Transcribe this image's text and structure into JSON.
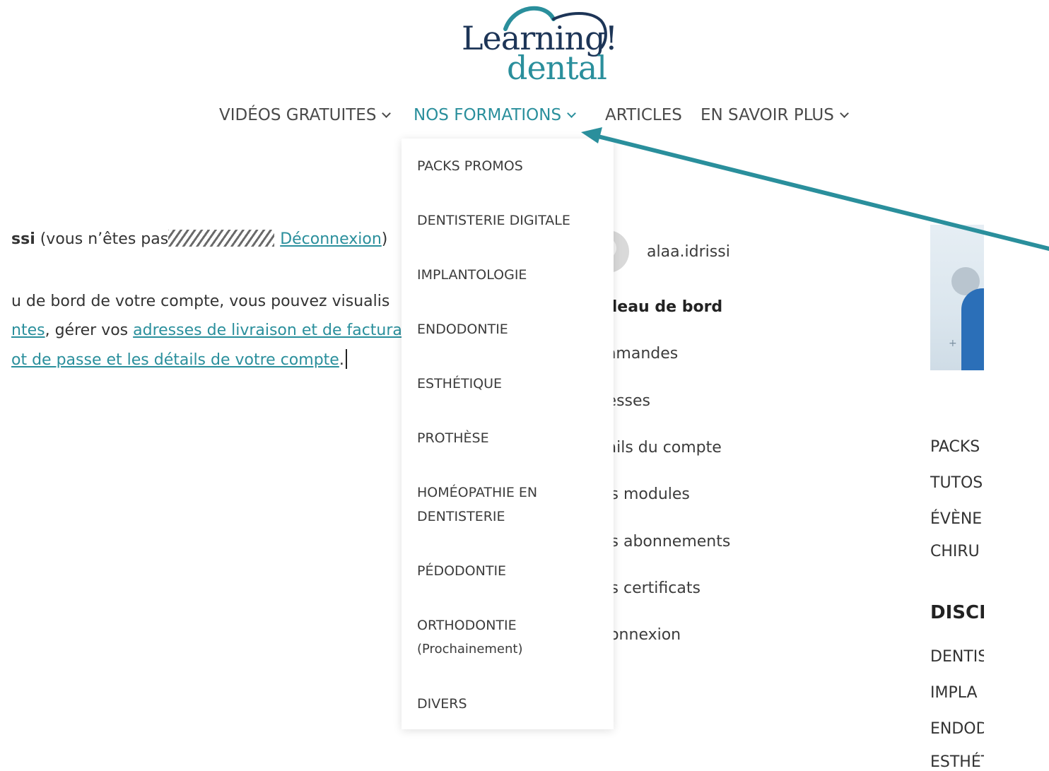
{
  "logo": {
    "line1": "Learning!",
    "line2": "dental",
    "brand_navy": "#1d3557",
    "brand_teal": "#2a8f9c"
  },
  "nav": {
    "items": [
      {
        "label": "VIDÉOS GRATUITES"
      },
      {
        "label": "NOS FORMATIONS"
      },
      {
        "label": "ARTICLES"
      },
      {
        "label": "EN SAVOIR PLUS"
      }
    ],
    "active_index": 1
  },
  "dropdown": {
    "items": [
      {
        "label": "PACKS PROMOS"
      },
      {
        "label": "DENTISTERIE DIGITALE"
      },
      {
        "label": "IMPLANTOLOGIE"
      },
      {
        "label": "ENDODONTIE"
      },
      {
        "label": "ESTHÉTIQUE"
      },
      {
        "label": "PROTHÈSE"
      },
      {
        "label": "HOMÉOPATHIE EN DENTISTERIE"
      },
      {
        "label": "PÉDODONTIE"
      },
      {
        "label": "ORTHODONTIE",
        "sub": "(Prochainement)"
      },
      {
        "label": "DIVERS"
      }
    ]
  },
  "content": {
    "l1_name": "ssi",
    "l1_text": " (vous n’êtes pas",
    "l1_logout": "Déconnexion",
    "l1_close": ")",
    "l2": "u de bord de votre compte, vous pouvez visualis",
    "l3_link1": "ntes",
    "l3_text": ", gérer vos ",
    "l3_link2": "adresses de livraison et de factura",
    "l4_link": "ot de passe et les détails de votre compte",
    "l4_end": "."
  },
  "account": {
    "username": "alaa.idrissi",
    "items": [
      {
        "label": "bleau de bord"
      },
      {
        "label": "mmandes"
      },
      {
        "label": "resses"
      },
      {
        "label": "tails du compte"
      },
      {
        "label": "es modules"
      },
      {
        "label": "es abonnements"
      },
      {
        "label": "es certificats"
      },
      {
        "label": "connexion"
      }
    ]
  },
  "sidebar": {
    "links_top": [
      {
        "label": "PACKS"
      },
      {
        "label": "TUTOS"
      },
      {
        "label": "ÉVÈNE"
      },
      {
        "label": "CHIRU"
      }
    ],
    "heading": "DISCI",
    "links_bottom": [
      {
        "label": "DENTIS"
      },
      {
        "label": "IMPLA"
      },
      {
        "label": "ENDOD"
      },
      {
        "label": "ESTHÉT"
      }
    ]
  },
  "annotation": {
    "arrow_color": "#2a8f9c"
  }
}
